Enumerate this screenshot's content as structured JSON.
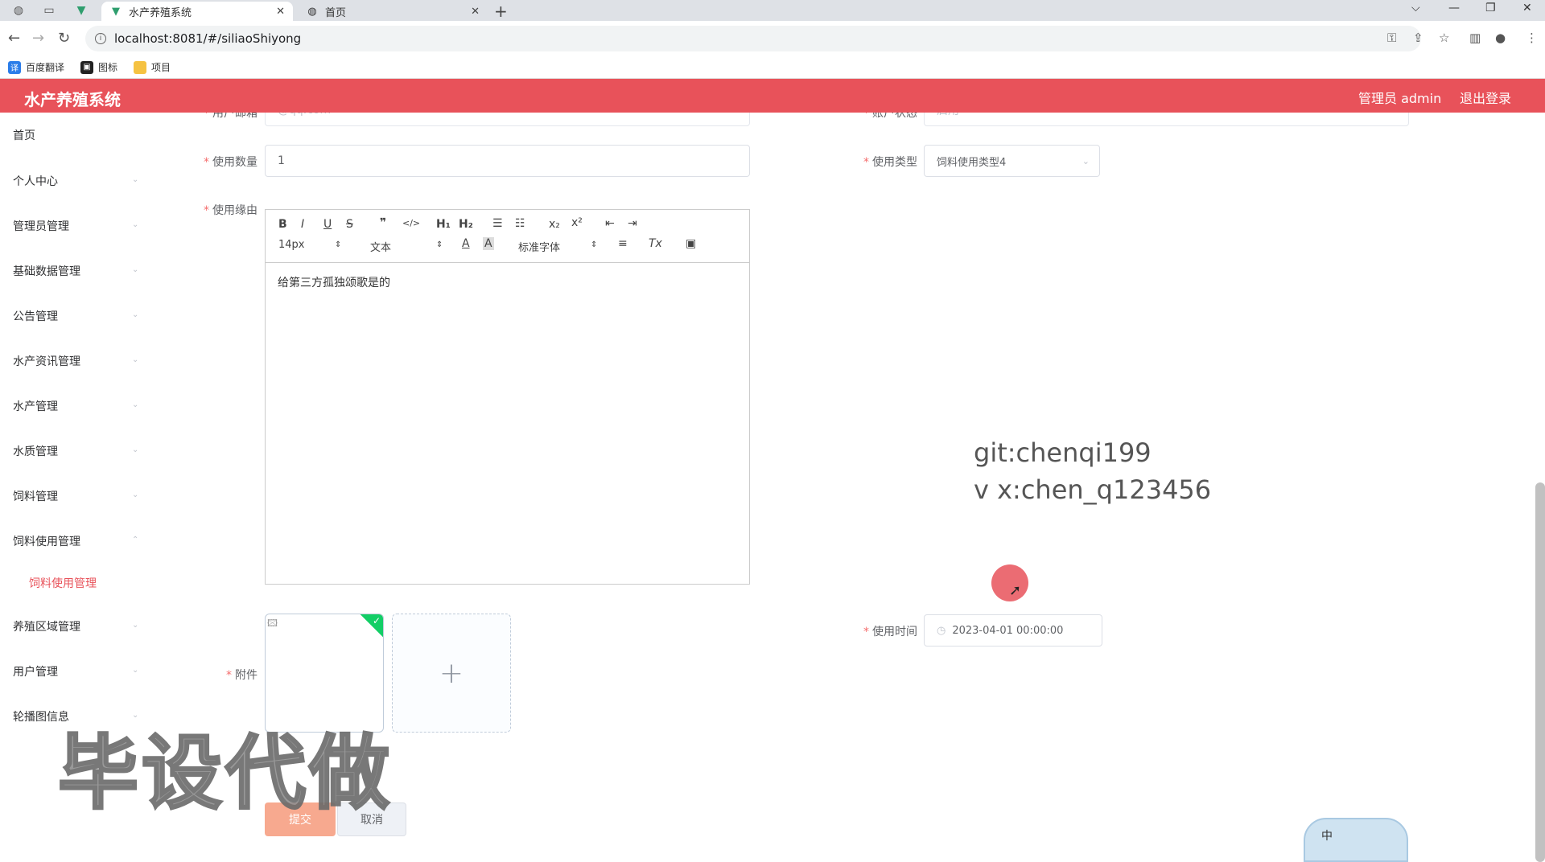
{
  "browser": {
    "tabs": [
      {
        "label": "水产养殖系统",
        "active": true
      },
      {
        "label": "首页",
        "active": false
      }
    ],
    "new_tab": "+",
    "window_controls": {
      "menu": "⌵",
      "minimize": "—",
      "restore": "❐",
      "close": "✕"
    },
    "url": "localhost:8081/#/siliaoShiyong",
    "bookmarks": [
      {
        "label": "百度翻译",
        "icon": "translate-icon",
        "color": "#2b7de9"
      },
      {
        "label": "图标",
        "icon": "image-icon",
        "color": "#222222"
      },
      {
        "label": "项目",
        "icon": "folder-icon",
        "color": "#f5c242"
      }
    ]
  },
  "header": {
    "title": "水产养殖系统",
    "user": "管理员 admin",
    "logout": "退出登录",
    "color": "#e8525a"
  },
  "sidebar": {
    "items": [
      "首页",
      "个人中心",
      "管理员管理",
      "基础数据管理",
      "公告管理",
      "水产资讯管理",
      "水产管理",
      "水质管理",
      "饲料管理",
      "饲料使用管理",
      "养殖区域管理",
      "用户管理",
      "轮播图信息"
    ],
    "active_sub": "饲料使用管理",
    "active_color": "#e8525a"
  },
  "form": {
    "top_left_label": "用户邮箱",
    "top_left_value": "@qq.com",
    "top_right_label": "账户状态",
    "top_right_value": "启用",
    "quantity_label": "使用数量",
    "quantity_value": "1",
    "type_label": "使用类型",
    "type_value": "饲料使用类型4",
    "reason_label": "使用缘由",
    "editor": {
      "size": "14px",
      "paragraph": "文本",
      "font": "标准字体",
      "content": "给第三方孤独颂歌是的"
    },
    "time_label": "使用时间",
    "time_value": "2023-04-01 00:00:00",
    "attachment_label": "附件",
    "submit": "提交",
    "cancel": "取消",
    "submit_color": "#f7a98f"
  },
  "overlays": {
    "git_line1": "git:chenqi199",
    "git_line2": "v x:chen_q123456",
    "watermark": "毕设代做",
    "ime": "中"
  }
}
